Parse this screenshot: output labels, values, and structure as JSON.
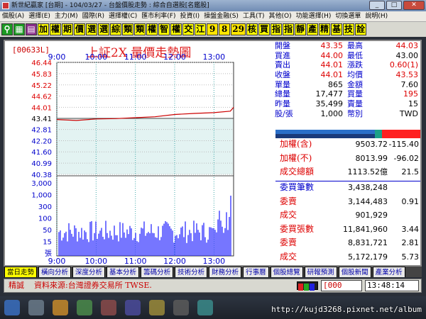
{
  "window": {
    "title": "新世紀贏家 [台期] - 104/03/27 - 台盤價股走勢 : 綜合自選股[名鑑股]",
    "minimize": "_",
    "maximize": "□",
    "close": "✕"
  },
  "menu": [
    "個股(A)",
    "選擇(E)",
    "主力(M)",
    "國際(R)",
    "選擇權(C)",
    "匯市利率(F)",
    "投資(I)",
    "操盤金融(S)",
    "工具(T)",
    "其他(O)",
    "功能選擇(H)",
    "切換選單",
    "說明(H)"
  ],
  "toolbar": [
    "加",
    "權",
    "期",
    "價",
    "選",
    "選",
    "綜",
    "類",
    "類",
    "權",
    "智",
    "權",
    "交",
    "江",
    "9",
    "8",
    "29",
    "核",
    "買",
    "指",
    "指",
    "靜",
    "產",
    "精",
    "基",
    "技",
    "詮"
  ],
  "symbol_code": "[00633L]",
  "chart_title": "上証2X  量價走勢圖",
  "price_axis": [
    "46.44",
    "45.83",
    "45.22",
    "44.62",
    "44.01",
    "43.41",
    "42.81",
    "42.20",
    "41.60",
    "40.99",
    "40.38"
  ],
  "volume_axis": [
    "3,000",
    "1,000",
    "300",
    "100",
    "50",
    "15",
    "張"
  ],
  "time_axis": [
    "9:00",
    "10:00",
    "11:00",
    "12:00",
    "13:00"
  ],
  "quote": [
    {
      "l1": "開盤",
      "v1": "43.35",
      "l2": "最高",
      "v2": "44.03"
    },
    {
      "l1": "買進",
      "v1": "44.00",
      "l2": "最低",
      "v2": "43.00"
    },
    {
      "l1": "賣出",
      "v1": "44.01",
      "l2": "漲跌",
      "v2": "0.60(1)"
    },
    {
      "l1": "收盤",
      "v1": "44.01",
      "l2": "均價",
      "v2": "43.53"
    },
    {
      "l1": "單量",
      "v1": "865",
      "l2": "金額",
      "v2": "7.60"
    },
    {
      "l1": "總量",
      "v1": "17,477",
      "l2": "買量",
      "v2": "195"
    },
    {
      "l1": "昨量",
      "v1": "35,499",
      "l2": "賣量",
      "v2": "15"
    },
    {
      "l1": "股/張",
      "v1": "1,000",
      "l2": "幣別",
      "v2": "TWD"
    }
  ],
  "index": [
    {
      "label": "加權(含)",
      "value": "9503.72",
      "change": "-115.40"
    },
    {
      "label": "加權(不)",
      "value": "8013.99",
      "change": "-96.02"
    },
    {
      "label": "成交總額",
      "value": "1113.52億",
      "change": "21.5"
    }
  ],
  "market": [
    {
      "label": "委買筆數",
      "value": "3,438,248",
      "change": ""
    },
    {
      "label": "委賣",
      "value": "3,144,483",
      "change": "0.91"
    },
    {
      "label": "成交",
      "value": "901,929",
      "change": ""
    },
    {
      "label": "委買張數",
      "value": "11,841,960",
      "change": "3.44"
    },
    {
      "label": "委賣",
      "value": "8,831,721",
      "change": "2.81"
    },
    {
      "label": "成交",
      "value": "5,172,179",
      "change": "5.73"
    }
  ],
  "tabs": [
    "當日走勢",
    "橫向分析",
    "深度分析",
    "基本分析",
    "籌碼分析",
    "技術分析",
    "財務分析",
    "行事曆",
    "個股總覽",
    "研報預測",
    "個股新聞",
    "產業分析"
  ],
  "status": {
    "label": "精誠",
    "source": "資料來源:台灣證券交易所 TWSE.",
    "input": "[000",
    "clock": "13:48:14"
  },
  "watermark": "http://kujd3268.pixnet.net/album",
  "chart_data": {
    "type": "line",
    "x": [
      "9:00",
      "9:30",
      "10:00",
      "10:30",
      "11:00",
      "11:30",
      "12:00",
      "12:30",
      "13:00",
      "13:25",
      "13:30"
    ],
    "series": [
      {
        "values": [
          43.35,
          43.3,
          43.38,
          43.4,
          43.45,
          43.5,
          43.62,
          43.68,
          43.72,
          43.8,
          44.01
        ]
      }
    ],
    "ylim": [
      40.38,
      46.44
    ],
    "reference": 43.41
  }
}
